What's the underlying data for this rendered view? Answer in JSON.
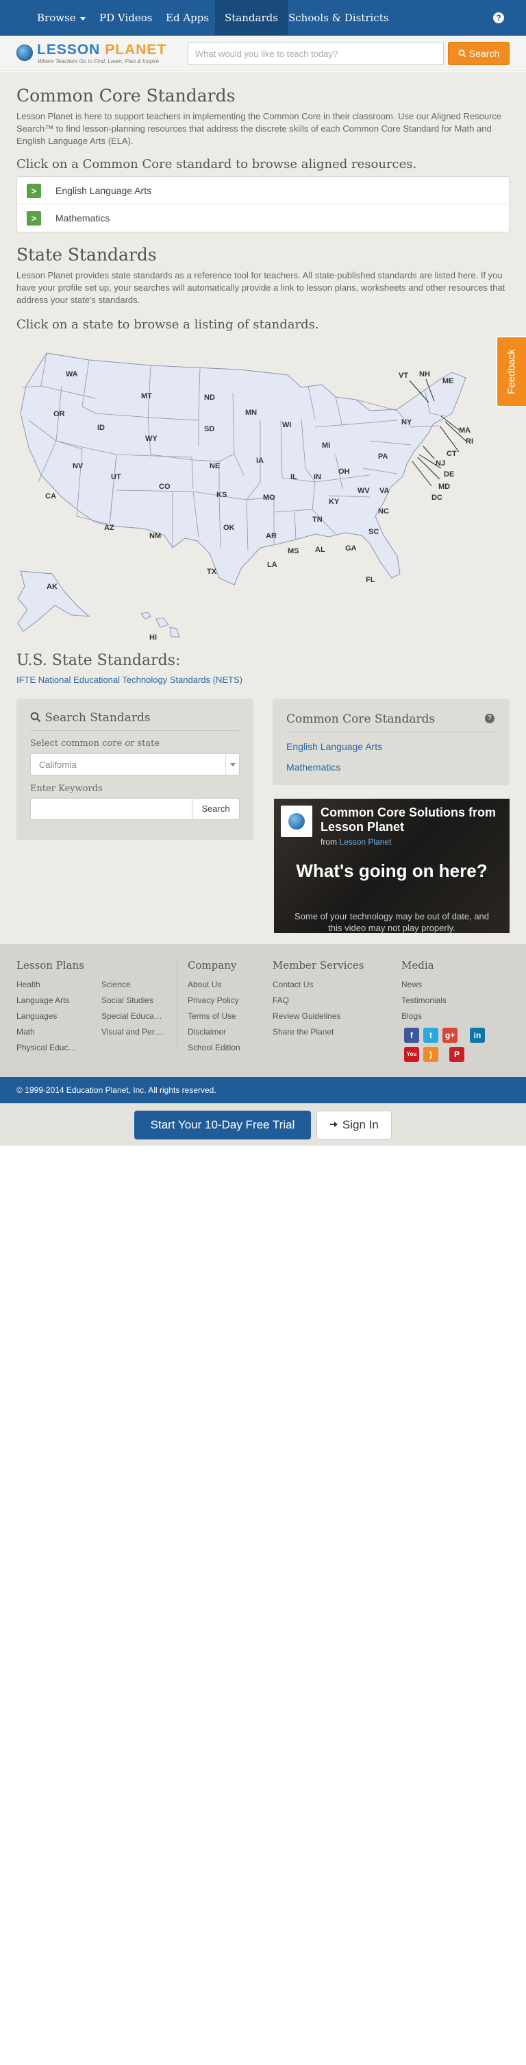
{
  "nav": {
    "items": [
      {
        "label": "Browse"
      },
      {
        "label": "PD Videos"
      },
      {
        "label": "Ed Apps"
      },
      {
        "label": "Standards"
      },
      {
        "label": "Schools & Districts"
      }
    ],
    "help": "?"
  },
  "header": {
    "logo_main": "LESSON",
    "logo_accent": "PLANET",
    "logo_tagline": "Where Teachers Go to Find, Learn, Plan & Inspire",
    "search_placeholder": "What would you like to teach today?",
    "search_button": "Search"
  },
  "common_core": {
    "title": "Common Core Standards",
    "description": "Lesson Planet is here to support teachers in implementing the Common Core in their classroom. Use our Aligned Resource Search™ to find lesson-planning resources that address the discrete skills of each Common Core Standard for Math and English Language Arts (ELA).",
    "prompt": "Click on a Common Core standard to browse aligned resources.",
    "items": [
      {
        "label": "English Language Arts"
      },
      {
        "label": "Mathematics"
      }
    ]
  },
  "state_standards": {
    "title": "State Standards",
    "description": "Lesson Planet provides state standards as a reference tool for teachers. All state-published standards are listed here. If you have your profile set up, your searches will automatically provide a link to lesson plans, worksheets and other resources that address your state's standards.",
    "prompt": "Click on a state to browse a listing of standards.",
    "map_labels": [
      "WA",
      "MT",
      "ND",
      "MN",
      "OR",
      "ID",
      "SD",
      "WI",
      "WY",
      "NE",
      "IA",
      "MI",
      "NV",
      "UT",
      "CO",
      "IL",
      "IN",
      "OH",
      "CA",
      "KS",
      "MO",
      "KY",
      "WV",
      "AZ",
      "NM",
      "OK",
      "AR",
      "TN",
      "VA",
      "NC",
      "TX",
      "LA",
      "MS",
      "AL",
      "GA",
      "SC",
      "FL",
      "AK",
      "HI",
      "VT",
      "NH",
      "ME",
      "MA",
      "NY",
      "RI",
      "CT",
      "PA",
      "NJ",
      "DE",
      "MD",
      "DC"
    ]
  },
  "us_standards": {
    "title": "U.S. State Standards:",
    "link": "IFTE National Educational Technology Standards (NETS)"
  },
  "search_panel": {
    "title": "Search Standards",
    "select_label": "Select common core or state",
    "select_value": "California",
    "keywords_label": "Enter Keywords",
    "button": "Search"
  },
  "cc_panel": {
    "title": "Common Core Standards",
    "links": [
      "English Language Arts",
      "Mathematics"
    ]
  },
  "video": {
    "title": "Common Core Solutions from Lesson Planet",
    "from_prefix": "from",
    "from_name": "Lesson Planet",
    "headline": "What's going on here?",
    "message": "Some of your technology may be out of date, and this video may not play properly."
  },
  "feedback": "Feedback",
  "footer": {
    "lesson_plans": {
      "title": "Lesson Plans",
      "col1": [
        "Health",
        "Language Arts",
        "Languages",
        "Math",
        "Physical Educ…"
      ],
      "col2": [
        "Science",
        "Social Studies",
        "Special Educa…",
        "Visual and Per…"
      ]
    },
    "company": {
      "title": "Company",
      "links": [
        "About Us",
        "Privacy Policy",
        "Terms of Use",
        "Disclaimer",
        "School Edition"
      ]
    },
    "member": {
      "title": "Member Services",
      "links": [
        "Contact Us",
        "FAQ",
        "Review Guidelines",
        "Share the Planet"
      ]
    },
    "media": {
      "title": "Media",
      "links": [
        "News",
        "Testimonials",
        "Blogs"
      ]
    },
    "social": [
      {
        "icon": "facebook-icon",
        "glyph": "f",
        "color": "#3b5998"
      },
      {
        "icon": "twitter-icon",
        "glyph": "t",
        "color": "#2aa9e0"
      },
      {
        "icon": "google-plus-icon",
        "glyph": "g+",
        "color": "#d34836"
      },
      {
        "icon": "linkedin-icon",
        "glyph": "in",
        "color": "#0e76a8"
      },
      {
        "icon": "youtube-icon",
        "glyph": "You",
        "color": "#cc181e"
      },
      {
        "icon": "rss-icon",
        "glyph": ")",
        "color": "#f08a24"
      },
      {
        "icon": "pinterest-icon",
        "glyph": "P",
        "color": "#cb2027"
      }
    ]
  },
  "copyright": "© 1999-2014 Education Planet, Inc. All rights reserved.",
  "cta": {
    "trial": "Start Your 10-Day Free Trial",
    "signin": "Sign In"
  },
  "colors": {
    "brand_blue": "#1f5c98",
    "accent_orange": "#f28c1e",
    "chevron_green": "#5aa046",
    "map_fill": "#e4e8f5"
  }
}
